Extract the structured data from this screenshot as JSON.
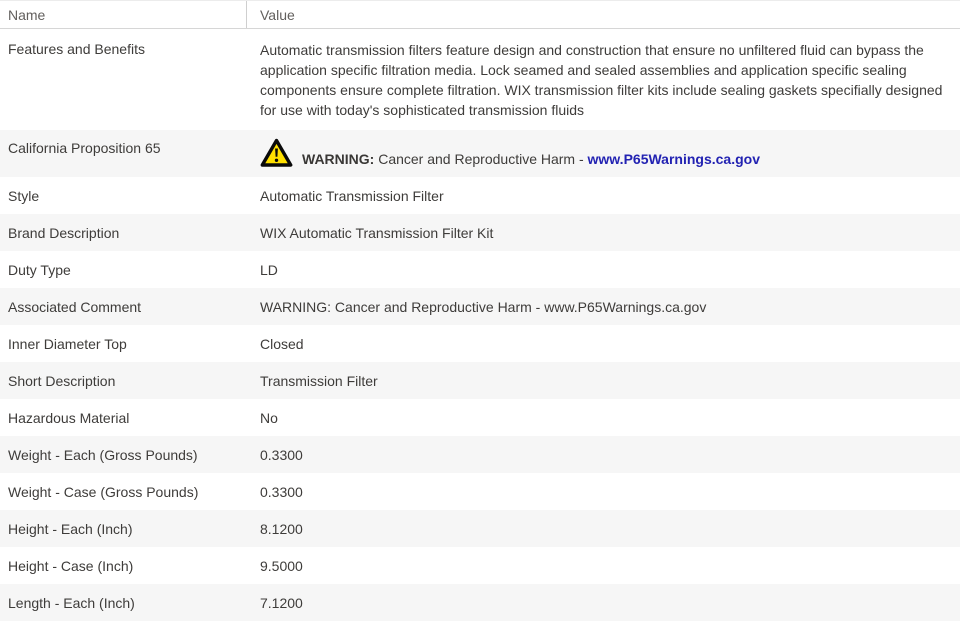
{
  "header": {
    "name_label": "Name",
    "value_label": "Value"
  },
  "rows": [
    {
      "name": "Features and Benefits",
      "value": "Automatic transmission filters feature design and construction that ensure no unfiltered fluid can bypass the application specific filtration media. Lock seamed and sealed assemblies and application specific sealing components ensure complete filtration. WIX transmission filter kits include sealing gaskets specifially designed for use with today's sophisticated transmission fluids"
    },
    {
      "name": "California Proposition 65",
      "icon": "warning-triangle-icon",
      "warning_label": "WARNING:",
      "warning_text": " Cancer and Reproductive Harm - ",
      "link_text": "www.P65Warnings.ca.gov"
    },
    {
      "name": "Style",
      "value": "Automatic Transmission Filter"
    },
    {
      "name": "Brand Description",
      "value": "WIX Automatic Transmission Filter Kit"
    },
    {
      "name": "Duty Type",
      "value": "LD"
    },
    {
      "name": "Associated Comment",
      "value": "WARNING: Cancer and Reproductive Harm - www.P65Warnings.ca.gov"
    },
    {
      "name": "Inner Diameter Top",
      "value": "Closed"
    },
    {
      "name": "Short Description",
      "value": "Transmission Filter"
    },
    {
      "name": "Hazardous Material",
      "value": "No"
    },
    {
      "name": "Weight - Each (Gross Pounds)",
      "value": "0.3300"
    },
    {
      "name": "Weight - Case (Gross Pounds)",
      "value": "0.3300"
    },
    {
      "name": "Height - Each (Inch)",
      "value": "8.1200"
    },
    {
      "name": "Height - Case (Inch)",
      "value": "9.5000"
    },
    {
      "name": "Length - Each (Inch)",
      "value": "7.1200"
    }
  ],
  "colors": {
    "row_alt_background": "#f6f6f6",
    "link_color": "#2222b2",
    "warning_yellow": "#ffe000",
    "header_text": "#625f5d",
    "body_text": "#3e3c3a"
  }
}
